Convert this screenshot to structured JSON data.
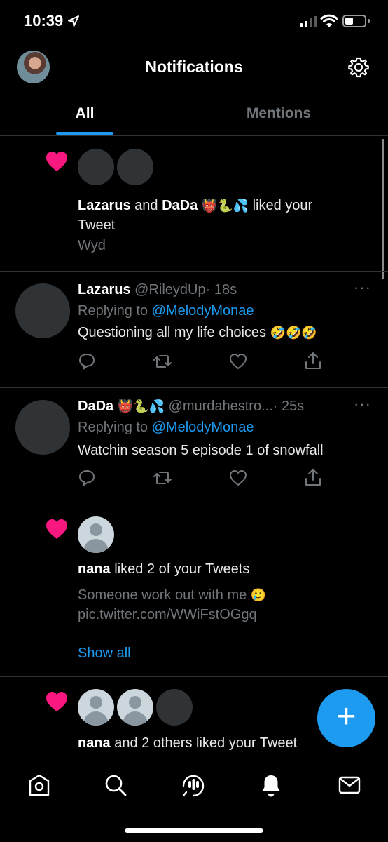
{
  "status_bar": {
    "time": "10:39",
    "icons": [
      "location-arrow-icon",
      "signal-icon",
      "wifi-icon",
      "battery-icon"
    ]
  },
  "header": {
    "title": "Notifications",
    "settings_icon": "gear-icon"
  },
  "tabs": [
    {
      "label": "All",
      "active": true
    },
    {
      "label": "Mentions",
      "active": false
    }
  ],
  "notifications": [
    {
      "type": "like",
      "actor1": "Lazarus",
      "joiner": "and",
      "actor2": "DaDa",
      "actor2_emoji": "👹🐍💦",
      "action": "liked your",
      "action_line2": "Tweet",
      "snippet": "Wyd"
    },
    {
      "type": "reply",
      "name": "Lazarus",
      "handle": "@RileydUp",
      "time": "· 18s",
      "replying_prefix": "Replying to",
      "replying_to": "@MelodyMonae",
      "text": "Questioning all my life choices",
      "text_emoji": "🤣🤣🤣",
      "more": "···"
    },
    {
      "type": "reply",
      "name": "DaDa",
      "name_emoji": "👹🐍💦",
      "handle": "@murdahestro...",
      "time": "· 25s",
      "replying_prefix": "Replying to",
      "replying_to": "@MelodyMonae",
      "text": "Watchin season 5 episode 1 of snowfall",
      "more": "···"
    },
    {
      "type": "like",
      "actor1": "nana",
      "action": "liked 2 of your Tweets",
      "snippet": "Someone work out with me",
      "snippet_emoji": "🥲",
      "snippet_link": "pic.twitter.com/WWiFstOGgq",
      "show_all": "Show all"
    },
    {
      "type": "like",
      "actor1": "nana",
      "action": "and 2 others liked your Tweet"
    }
  ],
  "fab": {
    "label": "+"
  },
  "bottom_nav": [
    "home-icon",
    "search-icon",
    "spaces-icon",
    "notifications-icon",
    "messages-icon"
  ],
  "colors": {
    "accent": "#1d9bf0",
    "heart": "#f91880",
    "muted": "#71767b",
    "divider": "#2f3336"
  }
}
